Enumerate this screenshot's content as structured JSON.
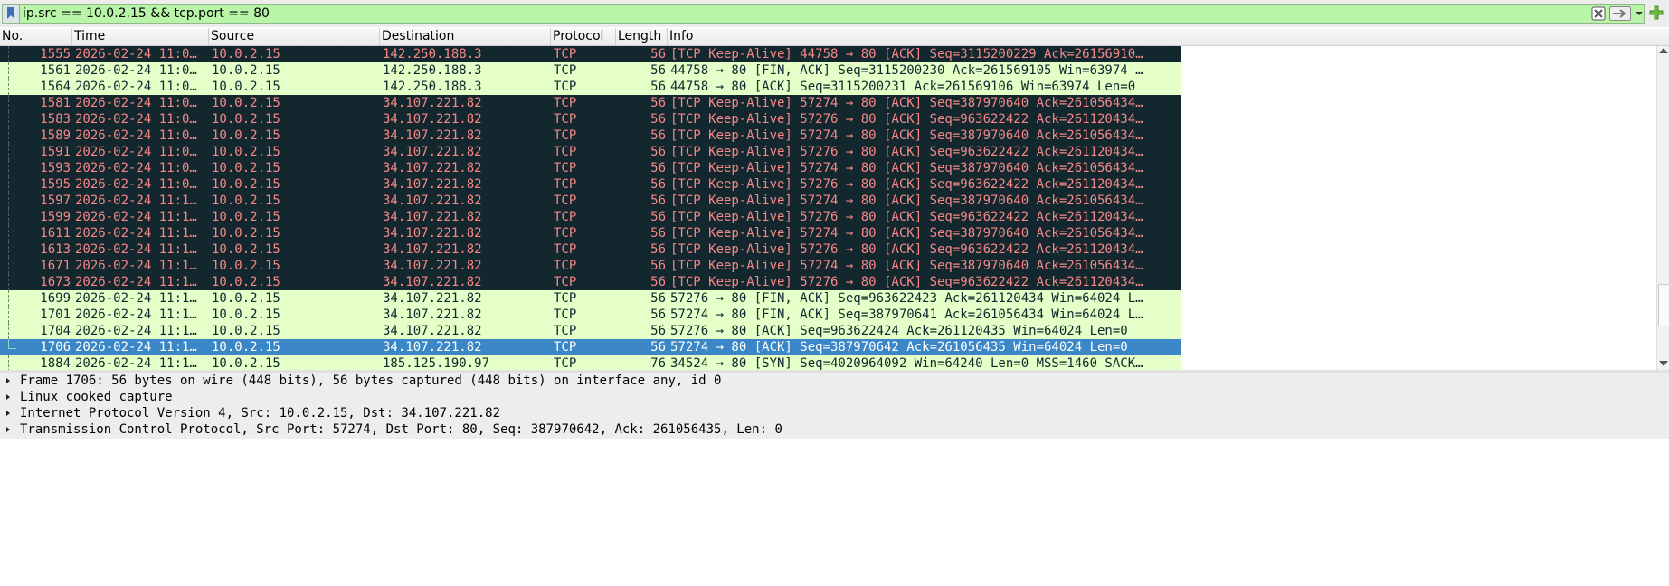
{
  "filter": {
    "expression": "ip.src == 10.0.2.15 && tcp.port == 80",
    "bg_color": "#b9f5a8"
  },
  "icons": {
    "bookmark": "bookmark-icon",
    "clear": "clear-filter-icon",
    "apply": "apply-filter-arrow-icon",
    "dropdown": "chevron-down-icon",
    "add": "add-filter-plus-icon"
  },
  "columns": [
    "No.",
    "Time",
    "Source",
    "Destination",
    "Protocol",
    "Length",
    "Info"
  ],
  "rows": [
    {
      "no": "1555",
      "time": "2026-02-24 11:0…",
      "src": "10.0.2.15",
      "dst": "142.250.188.3",
      "proto": "TCP",
      "len": "56",
      "info": "[TCP Keep-Alive] 44758 → 80 [ACK] Seq=3115200229 Ack=26156910…",
      "style": "ka"
    },
    {
      "no": "1561",
      "time": "2026-02-24 11:0…",
      "src": "10.0.2.15",
      "dst": "142.250.188.3",
      "proto": "TCP",
      "len": "56",
      "info": "44758 → 80 [FIN, ACK] Seq=3115200230 Ack=261569105 Win=63974 …",
      "style": "fin"
    },
    {
      "no": "1564",
      "time": "2026-02-24 11:0…",
      "src": "10.0.2.15",
      "dst": "142.250.188.3",
      "proto": "TCP",
      "len": "56",
      "info": "44758 → 80 [ACK] Seq=3115200231 Ack=261569106 Win=63974 Len=0",
      "style": "fin"
    },
    {
      "no": "1581",
      "time": "2026-02-24 11:0…",
      "src": "10.0.2.15",
      "dst": "34.107.221.82",
      "proto": "TCP",
      "len": "56",
      "info": "[TCP Keep-Alive] 57274 → 80 [ACK] Seq=387970640 Ack=261056434…",
      "style": "ka"
    },
    {
      "no": "1583",
      "time": "2026-02-24 11:0…",
      "src": "10.0.2.15",
      "dst": "34.107.221.82",
      "proto": "TCP",
      "len": "56",
      "info": "[TCP Keep-Alive] 57276 → 80 [ACK] Seq=963622422 Ack=261120434…",
      "style": "ka"
    },
    {
      "no": "1589",
      "time": "2026-02-24 11:0…",
      "src": "10.0.2.15",
      "dst": "34.107.221.82",
      "proto": "TCP",
      "len": "56",
      "info": "[TCP Keep-Alive] 57274 → 80 [ACK] Seq=387970640 Ack=261056434…",
      "style": "ka"
    },
    {
      "no": "1591",
      "time": "2026-02-24 11:0…",
      "src": "10.0.2.15",
      "dst": "34.107.221.82",
      "proto": "TCP",
      "len": "56",
      "info": "[TCP Keep-Alive] 57276 → 80 [ACK] Seq=963622422 Ack=261120434…",
      "style": "ka"
    },
    {
      "no": "1593",
      "time": "2026-02-24 11:0…",
      "src": "10.0.2.15",
      "dst": "34.107.221.82",
      "proto": "TCP",
      "len": "56",
      "info": "[TCP Keep-Alive] 57274 → 80 [ACK] Seq=387970640 Ack=261056434…",
      "style": "ka"
    },
    {
      "no": "1595",
      "time": "2026-02-24 11:0…",
      "src": "10.0.2.15",
      "dst": "34.107.221.82",
      "proto": "TCP",
      "len": "56",
      "info": "[TCP Keep-Alive] 57276 → 80 [ACK] Seq=963622422 Ack=261120434…",
      "style": "ka"
    },
    {
      "no": "1597",
      "time": "2026-02-24 11:1…",
      "src": "10.0.2.15",
      "dst": "34.107.221.82",
      "proto": "TCP",
      "len": "56",
      "info": "[TCP Keep-Alive] 57274 → 80 [ACK] Seq=387970640 Ack=261056434…",
      "style": "ka"
    },
    {
      "no": "1599",
      "time": "2026-02-24 11:1…",
      "src": "10.0.2.15",
      "dst": "34.107.221.82",
      "proto": "TCP",
      "len": "56",
      "info": "[TCP Keep-Alive] 57276 → 80 [ACK] Seq=963622422 Ack=261120434…",
      "style": "ka"
    },
    {
      "no": "1611",
      "time": "2026-02-24 11:1…",
      "src": "10.0.2.15",
      "dst": "34.107.221.82",
      "proto": "TCP",
      "len": "56",
      "info": "[TCP Keep-Alive] 57274 → 80 [ACK] Seq=387970640 Ack=261056434…",
      "style": "ka"
    },
    {
      "no": "1613",
      "time": "2026-02-24 11:1…",
      "src": "10.0.2.15",
      "dst": "34.107.221.82",
      "proto": "TCP",
      "len": "56",
      "info": "[TCP Keep-Alive] 57276 → 80 [ACK] Seq=963622422 Ack=261120434…",
      "style": "ka"
    },
    {
      "no": "1671",
      "time": "2026-02-24 11:1…",
      "src": "10.0.2.15",
      "dst": "34.107.221.82",
      "proto": "TCP",
      "len": "56",
      "info": "[TCP Keep-Alive] 57274 → 80 [ACK] Seq=387970640 Ack=261056434…",
      "style": "ka"
    },
    {
      "no": "1673",
      "time": "2026-02-24 11:1…",
      "src": "10.0.2.15",
      "dst": "34.107.221.82",
      "proto": "TCP",
      "len": "56",
      "info": "[TCP Keep-Alive] 57276 → 80 [ACK] Seq=963622422 Ack=261120434…",
      "style": "ka"
    },
    {
      "no": "1699",
      "time": "2026-02-24 11:1…",
      "src": "10.0.2.15",
      "dst": "34.107.221.82",
      "proto": "TCP",
      "len": "56",
      "info": "57276 → 80 [FIN, ACK] Seq=963622423 Ack=261120434 Win=64024 L…",
      "style": "fin"
    },
    {
      "no": "1701",
      "time": "2026-02-24 11:1…",
      "src": "10.0.2.15",
      "dst": "34.107.221.82",
      "proto": "TCP",
      "len": "56",
      "info": "57274 → 80 [FIN, ACK] Seq=387970641 Ack=261056434 Win=64024 L…",
      "style": "fin"
    },
    {
      "no": "1704",
      "time": "2026-02-24 11:1…",
      "src": "10.0.2.15",
      "dst": "34.107.221.82",
      "proto": "TCP",
      "len": "56",
      "info": "57276 → 80 [ACK] Seq=963622424 Ack=261120435 Win=64024 Len=0",
      "style": "fin"
    },
    {
      "no": "1706",
      "time": "2026-02-24 11:1…",
      "src": "10.0.2.15",
      "dst": "34.107.221.82",
      "proto": "TCP",
      "len": "56",
      "info": "57274 → 80 [ACK] Seq=387970642 Ack=261056435 Win=64024 Len=0",
      "style": "sel"
    },
    {
      "no": "1884",
      "time": "2026-02-24 11:1…",
      "src": "10.0.2.15",
      "dst": "185.125.190.97",
      "proto": "TCP",
      "len": "76",
      "info": "34524 → 80 [SYN] Seq=4020964092 Win=64240 Len=0 MSS=1460 SACK…",
      "style": "fin"
    }
  ],
  "details": [
    "Frame 1706: 56 bytes on wire (448 bits), 56 bytes captured (448 bits) on interface any, id 0",
    "Linux cooked capture",
    "Internet Protocol Version 4, Src: 10.0.2.15, Dst: 34.107.221.82",
    "Transmission Control Protocol, Src Port: 57274, Dst Port: 80, Seq: 387970642, Ack: 261056435, Len: 0"
  ],
  "colors": {
    "keepalive_bg": "#12272e",
    "keepalive_fg": "#f78787",
    "fin_bg": "#e4ffc7",
    "selected_bg": "#3a86c6"
  }
}
